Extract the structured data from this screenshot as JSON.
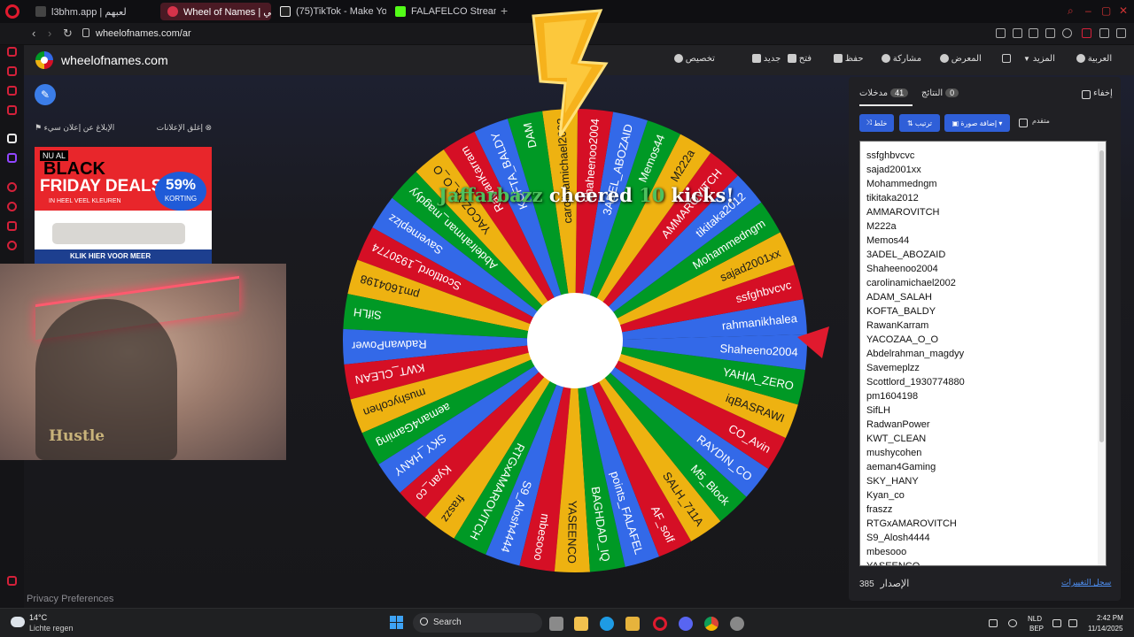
{
  "browser": {
    "tabs": [
      {
        "label": "l3bhm.app | لعبهم",
        "active": false
      },
      {
        "label": "Wheel of Names | الي",
        "active": true
      },
      {
        "label": "(75)TikTok - Make Your D",
        "active": false
      },
      {
        "label": "FALAFELCO Stream - Wat",
        "active": false
      }
    ],
    "url": "wheelofnames.com/ar"
  },
  "site": {
    "name": "wheelofnames.com",
    "menu": {
      "language": "العربية",
      "more": "المزيد",
      "gallery": "المعرض",
      "share": "مشاركة",
      "save": "حفظ",
      "open": "فتح",
      "new": "جديد",
      "customize": "تخصيص"
    }
  },
  "ads": {
    "close_ads": "إغلق الإعلانات",
    "report_ad": "الإبلاغ عن إعلان سيء",
    "banner": {
      "nu_al": "NU AL",
      "line1": "BLACK",
      "line2": "FRIDAY DEALS",
      "sub": "IN HEEL VEEL KLEUREN",
      "badge_pct": "59%",
      "badge_text": "KORTING",
      "cta": "KLIK HIER VOOR MEER"
    }
  },
  "webcam": {
    "shirt_text": "Hustle"
  },
  "wheel": {
    "colors": [
      "#3369e8",
      "#d50f25",
      "#eeb211",
      "#009925"
    ],
    "segments": [
      "rahmanikhalea",
      "ssfghbvcvc",
      "sajad2001xx",
      "Mohammedngm",
      "tikitaka2012",
      "AMMAROVITCH",
      "M222a",
      "Memos44",
      "3ADEL_ABOZAID",
      "Shaheenoo2004",
      "carolinamichael2002",
      "DAM",
      "KOFTA_BALDY",
      "RawanKarram",
      "YACOZAA_O_O",
      "Abdelrahman_magdyy",
      "Savemeplzz",
      "Scottlord_1930774",
      "pm1604198",
      "SifLH",
      "RadwanPower",
      "KWT_CLEAN",
      "mushycohen",
      "aeman4Gaming",
      "SKY_HANY",
      "Kyan_co",
      "fraszz",
      "RTGxAMAROVITCH",
      "S9_Alosh4444",
      "mbesooo",
      "YASEENCO",
      "BAGHDAD_IQ",
      "points_FALAFEL",
      "AF_solf",
      "SALH_711A",
      "M5_Block",
      "RAYDIN_CO",
      "CO_Avin",
      "iqBASRAWI",
      "YAHIA_ZERO",
      "Shaheeno2004"
    ]
  },
  "cheer": {
    "name": "Jaffarbazz",
    "mid": "cheered",
    "count": "10",
    "end": "kicks!"
  },
  "privacy": "Privacy Preferences",
  "panel": {
    "hide_label": "إخفاء",
    "results_label": "النتائج",
    "results_count": "0",
    "entries_label": "مدخلات",
    "entries_count": "41",
    "shuffle": "خلط",
    "sort": "ترتيب",
    "add_image": "إضافة صورة",
    "advanced": "متقدم",
    "entries": [
      "ssfghbvcvc",
      "sajad2001xx",
      "Mohammedngm",
      "tikitaka2012",
      "AMMAROVITCH",
      "M222a",
      "Memos44",
      "3ADEL_ABOZAID",
      "Shaheenoo2004",
      "carolinamichael2002",
      "ADAM_SALAH",
      "KOFTA_BALDY",
      "RawanKarram",
      "YACOZAA_O_O",
      "Abdelrahman_magdyy",
      "Savemeplzz",
      "Scottlord_1930774880",
      "pm1604198",
      "SifLH",
      "RadwanPower",
      "KWT_CLEAN",
      "mushycohen",
      "aeman4Gaming",
      "SKY_HANY",
      "Kyan_co",
      "fraszz",
      "RTGxAMAROVITCH",
      "S9_Alosh4444",
      "mbesooo",
      "YASEENCO"
    ],
    "version_label": "الإصدار",
    "version": "385",
    "changelog": "سجل التغييرات"
  },
  "taskbar": {
    "temp": "14°C",
    "weather": "Lichte regen",
    "search": "Search",
    "lang1": "NLD",
    "lang2": "BEP",
    "time": "2:42 PM",
    "date": "11/14/2025"
  }
}
